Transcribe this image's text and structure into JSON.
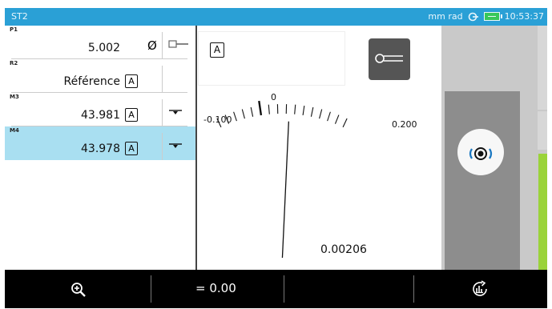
{
  "titlebar": {
    "title": "ST2",
    "units": "mm rad",
    "time": "10:53:37",
    "icons": [
      "probe-connection-icon",
      "battery-icon"
    ],
    "colors": {
      "bar": "#2aa0d6",
      "battery": "#38c75a"
    }
  },
  "measurements": [
    {
      "label": "P1",
      "value": "5.002",
      "badge": "",
      "symbol": "Ø",
      "icon": "probe-tip-icon",
      "selected": false
    },
    {
      "label": "R2",
      "value": "Référence",
      "badge": "A",
      "symbol": "",
      "icon": "",
      "selected": false
    },
    {
      "label": "M3",
      "value": "43.981",
      "badge": "A",
      "symbol": "",
      "icon": "distance-marker-icon",
      "selected": false
    },
    {
      "label": "M4",
      "value": "43.978",
      "badge": "A",
      "symbol": "",
      "icon": "distance-marker-icon",
      "selected": true
    }
  ],
  "gauge": {
    "mode_badge": "A",
    "scale_min": "-0.100",
    "scale_zero": "0",
    "scale_max": "0.200",
    "reading": "0.00206",
    "reading_value": 0.00206
  },
  "toolbar": {
    "zoom_icon": "zoom-in-icon",
    "offset_label": "= 0.00",
    "stats_icon": "statistics-refresh-icon"
  },
  "colors": {
    "selection": "#a9dff1",
    "accent_green": "#9ad33a"
  }
}
